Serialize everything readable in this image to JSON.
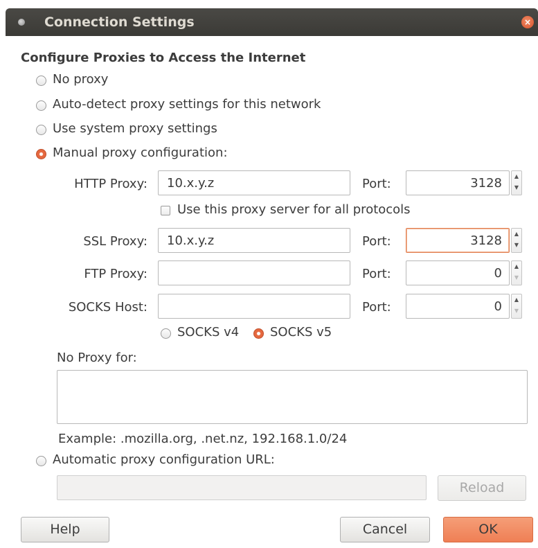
{
  "window": {
    "title": "Connection Settings",
    "close_glyph": "×"
  },
  "dialog": {
    "section_title": "Configure Proxies to Access the Internet",
    "radios": {
      "no_proxy": {
        "label": "No proxy",
        "checked": false
      },
      "auto_detect": {
        "label": "Auto-detect proxy settings for this network",
        "checked": false
      },
      "system": {
        "label": "Use system proxy settings",
        "checked": false
      },
      "manual": {
        "label": "Manual proxy configuration:",
        "checked": true
      },
      "auto_url": {
        "label": "Automatic proxy configuration URL:",
        "checked": false
      }
    },
    "http": {
      "label": "HTTP Proxy:",
      "value": "10.x.y.z",
      "port_label": "Port:",
      "port": "3128"
    },
    "use_all": {
      "label": "Use this proxy server for all protocols",
      "checked": false
    },
    "ssl": {
      "label": "SSL Proxy:",
      "value": "10.x.y.z",
      "port_label": "Port:",
      "port": "3128"
    },
    "ftp": {
      "label": "FTP Proxy:",
      "value": "",
      "port_label": "Port:",
      "port": "0"
    },
    "socks": {
      "label": "SOCKS Host:",
      "value": "",
      "port_label": "Port:",
      "port": "0"
    },
    "socks_v4": {
      "label": "SOCKS v4",
      "checked": false
    },
    "socks_v5": {
      "label": "SOCKS v5",
      "checked": true
    },
    "no_proxy_for": {
      "label": "No Proxy for:",
      "value": ""
    },
    "example": "Example: .mozilla.org, .net.nz, 192.168.1.0/24",
    "auto_url_value": "",
    "buttons": {
      "reload": "Reload",
      "help": "Help",
      "cancel": "Cancel",
      "ok": "OK"
    },
    "spin_up": "▲",
    "spin_down": "▼"
  },
  "colors": {
    "accent": "#e5683f",
    "ok_button": "#ef7f55",
    "titlebar": "#3b3a36"
  }
}
